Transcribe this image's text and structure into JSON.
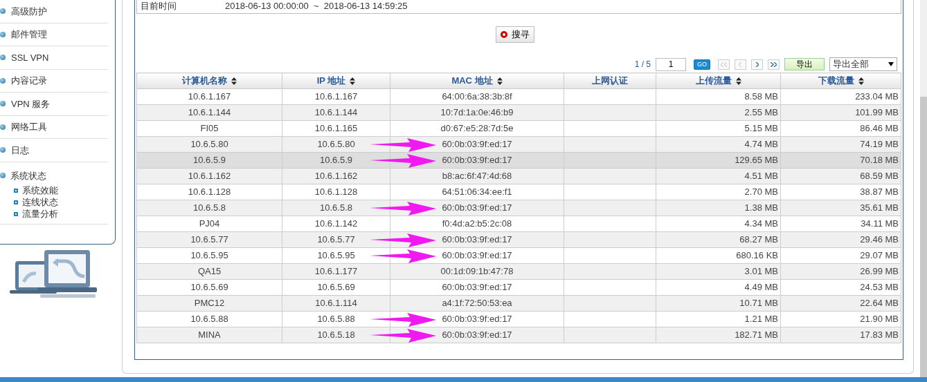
{
  "sidebar": {
    "items": [
      {
        "label": "高级防护"
      },
      {
        "label": "邮件管理"
      },
      {
        "label": "SSL VPN"
      },
      {
        "label": "内容记录"
      },
      {
        "label": "VPN 服务"
      },
      {
        "label": "网络工具"
      },
      {
        "label": "日志"
      },
      {
        "label": "系统状态",
        "children": [
          {
            "label": "系统效能"
          },
          {
            "label": "连线状态"
          },
          {
            "label": "流量分析"
          }
        ]
      }
    ]
  },
  "time_range": {
    "label": "目前时间",
    "value": "2018-06-13 00:00:00  ~  2018-06-13 14:59:25"
  },
  "search_button": "搜寻",
  "pager": {
    "page": "1 / 5",
    "page_input": "1",
    "go": "GO",
    "export": "导出",
    "export_option": "导出全部"
  },
  "table": {
    "columns": [
      {
        "label": "计算机名称",
        "sortable": true
      },
      {
        "label": "IP 地址",
        "sortable": true
      },
      {
        "label": "MAC 地址",
        "sortable": true
      },
      {
        "label": "上网认证",
        "sortable": false
      },
      {
        "label": "上传流量",
        "sortable": true
      },
      {
        "label": "下载流量",
        "sortable": true
      }
    ],
    "rows": [
      {
        "cells": [
          "10.6.1.167",
          "10.6.1.167",
          "64:00:6a:38:3b:8f",
          "",
          "8.58 MB",
          "233.04 MB"
        ],
        "selected": false,
        "marked": false
      },
      {
        "cells": [
          "10.6.1.144",
          "10.6.1.144",
          "10:7d:1a:0e:46:b9",
          "",
          "2.55 MB",
          "101.99 MB"
        ],
        "selected": false,
        "marked": false
      },
      {
        "cells": [
          "FI05",
          "10.6.1.165",
          "d0:67:e5:28:7d:5e",
          "",
          "5.15 MB",
          "86.46 MB"
        ],
        "selected": false,
        "marked": false
      },
      {
        "cells": [
          "10.6.5.80",
          "10.6.5.80",
          "60:0b:03:9f:ed:17",
          "",
          "4.74 MB",
          "74.19 MB"
        ],
        "selected": false,
        "marked": true
      },
      {
        "cells": [
          "10.6.5.9",
          "10.6.5.9",
          "60:0b:03:9f:ed:17",
          "",
          "129.65 MB",
          "70.18 MB"
        ],
        "selected": true,
        "marked": true
      },
      {
        "cells": [
          "10.6.1.162",
          "10.6.1.162",
          "b8:ac:6f:47:4d:68",
          "",
          "4.51 MB",
          "68.59 MB"
        ],
        "selected": false,
        "marked": false
      },
      {
        "cells": [
          "10.6.1.128",
          "10.6.1.128",
          "64:51:06:34:ee:f1",
          "",
          "2.70 MB",
          "38.87 MB"
        ],
        "selected": false,
        "marked": false
      },
      {
        "cells": [
          "10.6.5.8",
          "10.6.5.8",
          "60:0b:03:9f:ed:17",
          "",
          "1.38 MB",
          "35.61 MB"
        ],
        "selected": false,
        "marked": true
      },
      {
        "cells": [
          "PJ04",
          "10.6.1.142",
          "f0:4d:a2:b5:2c:08",
          "",
          "4.34 MB",
          "34.11 MB"
        ],
        "selected": false,
        "marked": false
      },
      {
        "cells": [
          "10.6.5.77",
          "10.6.5.77",
          "60:0b:03:9f:ed:17",
          "",
          "68.27 MB",
          "29.46 MB"
        ],
        "selected": false,
        "marked": true
      },
      {
        "cells": [
          "10.6.5.95",
          "10.6.5.95",
          "60:0b:03:9f:ed:17",
          "",
          "680.16 KB",
          "29.07 MB"
        ],
        "selected": false,
        "marked": true
      },
      {
        "cells": [
          "QA15",
          "10.6.1.177",
          "00:1d:09:1b:47:78",
          "",
          "3.01 MB",
          "26.99 MB"
        ],
        "selected": false,
        "marked": false
      },
      {
        "cells": [
          "10.6.5.69",
          "10.6.5.69",
          "60:0b:03:9f:ed:17",
          "",
          "4.49 MB",
          "24.53 MB"
        ],
        "selected": false,
        "marked": false
      },
      {
        "cells": [
          "PMC12",
          "10.6.1.114",
          "a4:1f:72:50:53:ea",
          "",
          "10.71 MB",
          "22.64 MB"
        ],
        "selected": false,
        "marked": false
      },
      {
        "cells": [
          "10.6.5.88",
          "10.6.5.88",
          "60:0b:03:9f:ed:17",
          "",
          "1.21 MB",
          "21.90 MB"
        ],
        "selected": false,
        "marked": true
      },
      {
        "cells": [
          "MINA",
          "10.6.5.18",
          "60:0b:03:9f:ed:17",
          "",
          "182.71 MB",
          "17.83 MB"
        ],
        "selected": false,
        "marked": true
      }
    ]
  }
}
